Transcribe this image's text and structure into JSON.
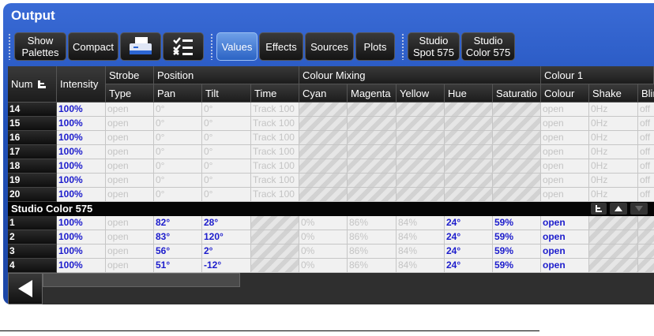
{
  "window": {
    "title": "Output"
  },
  "toolbar": {
    "show_palettes": "Show\nPalettes",
    "compact": "Compact",
    "values": "Values",
    "effects": "Effects",
    "sources": "Sources",
    "plots": "Plots",
    "studio_spot": "Studio\nSpot 575",
    "studio_color": "Studio\nColor 575"
  },
  "headers": {
    "num": "Num",
    "intensity": "Intensity",
    "strobe": "Strobe",
    "position": "Position",
    "colour_mixing": "Colour Mixing",
    "colour1": "Colour 1",
    "type": "Type",
    "pan": "Pan",
    "tilt": "Tilt",
    "time": "Time",
    "cyan": "Cyan",
    "magenta": "Magenta",
    "yellow": "Yellow",
    "hue": "Hue",
    "saturation": "Saturatio",
    "colour": "Colour",
    "shake": "Shake",
    "blink": "Blin"
  },
  "spot_rows": [
    {
      "num": "14",
      "intensity": "100%",
      "type": "open",
      "pan": "0°",
      "tilt": "0°",
      "time": "Track 100",
      "colour": "open",
      "shake": "0Hz",
      "blink": "off"
    },
    {
      "num": "15",
      "intensity": "100%",
      "type": "open",
      "pan": "0°",
      "tilt": "0°",
      "time": "Track 100",
      "colour": "open",
      "shake": "0Hz",
      "blink": "off"
    },
    {
      "num": "16",
      "intensity": "100%",
      "type": "open",
      "pan": "0°",
      "tilt": "0°",
      "time": "Track 100",
      "colour": "open",
      "shake": "0Hz",
      "blink": "off"
    },
    {
      "num": "17",
      "intensity": "100%",
      "type": "open",
      "pan": "0°",
      "tilt": "0°",
      "time": "Track 100",
      "colour": "open",
      "shake": "0Hz",
      "blink": "off"
    },
    {
      "num": "18",
      "intensity": "100%",
      "type": "open",
      "pan": "0°",
      "tilt": "0°",
      "time": "Track 100",
      "colour": "open",
      "shake": "0Hz",
      "blink": "off"
    },
    {
      "num": "19",
      "intensity": "100%",
      "type": "open",
      "pan": "0°",
      "tilt": "0°",
      "time": "Track 100",
      "colour": "open",
      "shake": "0Hz",
      "blink": "off"
    },
    {
      "num": "20",
      "intensity": "100%",
      "type": "open",
      "pan": "0°",
      "tilt": "0°",
      "time": "Track 100",
      "colour": "open",
      "shake": "0Hz",
      "blink": "off"
    }
  ],
  "group": {
    "label": "Studio Color 575"
  },
  "color_rows": [
    {
      "num": "1",
      "intensity": "100%",
      "type": "open",
      "pan": "82°",
      "tilt": "28°",
      "cyan": "0%",
      "magenta": "86%",
      "yellow": "84%",
      "hue": "24°",
      "saturation": "59%",
      "colour": "open"
    },
    {
      "num": "2",
      "intensity": "100%",
      "type": "open",
      "pan": "83°",
      "tilt": "120°",
      "cyan": "0%",
      "magenta": "86%",
      "yellow": "84%",
      "hue": "24°",
      "saturation": "59%",
      "colour": "open"
    },
    {
      "num": "3",
      "intensity": "100%",
      "type": "open",
      "pan": "56°",
      "tilt": "2°",
      "cyan": "0%",
      "magenta": "86%",
      "yellow": "84%",
      "hue": "24°",
      "saturation": "59%",
      "colour": "open"
    },
    {
      "num": "4",
      "intensity": "100%",
      "type": "open",
      "pan": "51°",
      "tilt": "-12°",
      "cyan": "0%",
      "magenta": "86%",
      "yellow": "84%",
      "hue": "24°",
      "saturation": "59%",
      "colour": "open"
    }
  ],
  "colors": {
    "accent": "#2a5cc4",
    "value_blue": "#1c1ccc",
    "dim": "#c4c4c4"
  }
}
